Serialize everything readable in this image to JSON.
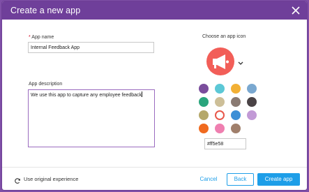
{
  "dialog": {
    "title": "Create a new app"
  },
  "form": {
    "app_name_required_mark": "*",
    "app_name_label": "App name",
    "app_name_value": "Internal Feedback App",
    "description_label": "App description",
    "description_value": "We use this app to capture any employee feedback"
  },
  "icon_picker": {
    "label": "Choose an app icon",
    "selected_icon": "megaphone-icon",
    "icon_background": "#f25e58",
    "colors": [
      "#7a4d9c",
      "#5cc8d6",
      "#f2b035",
      "#7aa8d0",
      "#2aa57d",
      "#cdbf98",
      "#8a7a72",
      "#4a4346",
      "#b5a86a",
      "#ffffff",
      "#3d8fd6",
      "#c29ad6",
      "#f06a1f",
      "#ef7fb0",
      "#a07f6b"
    ],
    "selected_index": 9,
    "hex_value": "#ff5e58"
  },
  "footer": {
    "original_experience_label": "Use original experience",
    "cancel_label": "Cancel",
    "back_label": "Back",
    "create_label": "Create app"
  },
  "colors": {
    "brand_purple": "#6f3f9a",
    "primary_blue": "#1e9ee8",
    "link_blue": "#1e9ee8"
  }
}
